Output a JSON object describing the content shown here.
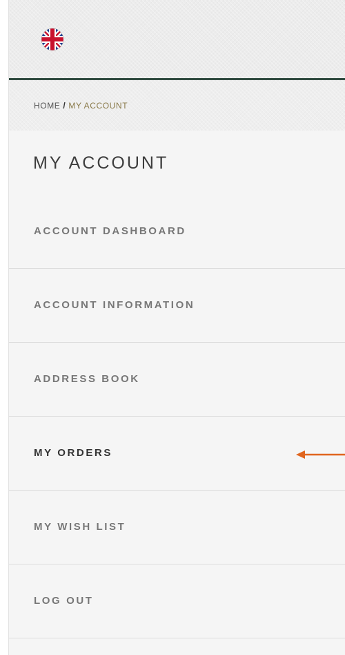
{
  "header": {
    "language_flag_icon": "uk-flag-icon"
  },
  "breadcrumb": {
    "home": "HOME",
    "separator": "/",
    "current": "MY ACCOUNT"
  },
  "page_title": "MY ACCOUNT",
  "nav": {
    "items": [
      {
        "label": "ACCOUNT DASHBOARD"
      },
      {
        "label": "ACCOUNT INFORMATION"
      },
      {
        "label": "ADDRESS BOOK"
      },
      {
        "label": "MY ORDERS",
        "active": true
      },
      {
        "label": "MY WISH LIST"
      },
      {
        "label": "LOG OUT"
      }
    ]
  },
  "annotation": {
    "arrow_color": "#e0651e",
    "arrow_icon": "left-arrow-icon"
  },
  "colors": {
    "header_border": "#2f4a3f",
    "breadcrumb_current": "#8a7a4a"
  }
}
